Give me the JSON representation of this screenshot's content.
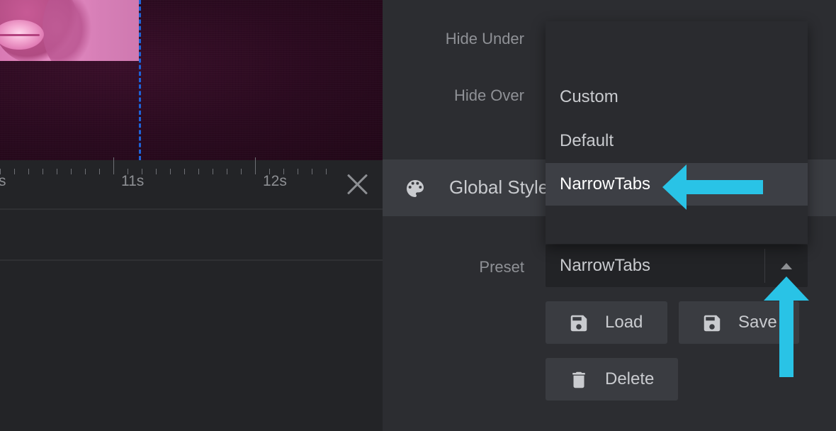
{
  "timeline": {
    "ruler_labels": [
      "s",
      "11s",
      "12s"
    ]
  },
  "panel": {
    "hide_under_label": "Hide Under",
    "hide_over_label": "Hide Over",
    "section_title": "Global Style",
    "preset_label": "Preset",
    "preset_value": "NarrowTabs",
    "load_label": "Load",
    "save_label": "Save",
    "delete_label": "Delete"
  },
  "dropdown": {
    "options": [
      "Custom",
      "Default",
      "NarrowTabs"
    ],
    "selected": "NarrowTabs"
  },
  "colors": {
    "accent_arrow": "#29c3e6",
    "guide_line": "#1e63d8",
    "frame_magenta": "#a8156e"
  },
  "icons": {
    "section": "palette-icon",
    "load": "floppy-disk-icon",
    "save": "floppy-disk-icon",
    "delete": "trash-icon",
    "close": "close-icon",
    "select": "caret-up-icon"
  }
}
